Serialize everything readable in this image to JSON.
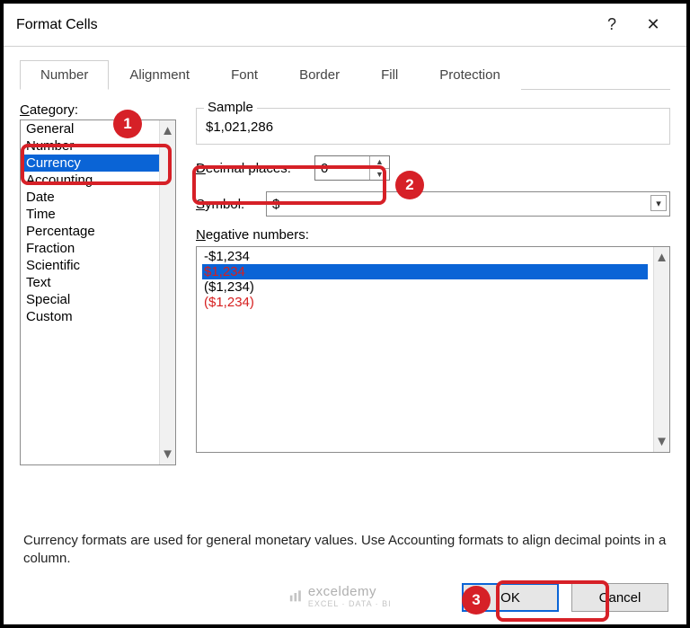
{
  "window": {
    "title": "Format Cells",
    "help_icon": "?",
    "close_icon": "✕"
  },
  "tabs": [
    "Number",
    "Alignment",
    "Font",
    "Border",
    "Fill",
    "Protection"
  ],
  "active_tab": "Number",
  "category_label": "Category:",
  "categories": [
    "General",
    "Number",
    "Currency",
    "Accounting",
    "Date",
    "Time",
    "Percentage",
    "Fraction",
    "Scientific",
    "Text",
    "Special",
    "Custom"
  ],
  "selected_category": "Currency",
  "sample": {
    "label": "Sample",
    "value": "$1,021,286"
  },
  "decimal": {
    "label": "Decimal places:",
    "underline_index": 0,
    "value": "0"
  },
  "symbol": {
    "label": "Symbol:",
    "underline_index": 0,
    "value": "$"
  },
  "negative": {
    "label": "Negative numbers:",
    "underline_index": 0,
    "items": [
      {
        "text": "-$1,234",
        "style": "plain"
      },
      {
        "text": "$1,234",
        "style": "red-selected"
      },
      {
        "text": "($1,234)",
        "style": "plain"
      },
      {
        "text": "($1,234)",
        "style": "red"
      }
    ]
  },
  "description": "Currency formats are used for general monetary values.  Use Accounting formats to align decimal points in a column.",
  "buttons": {
    "ok": "OK",
    "cancel": "Cancel"
  },
  "steps": {
    "s1": "1",
    "s2": "2",
    "s3": "3"
  },
  "watermark": {
    "brand": "exceldemy",
    "tagline": "EXCEL · DATA · BI"
  }
}
